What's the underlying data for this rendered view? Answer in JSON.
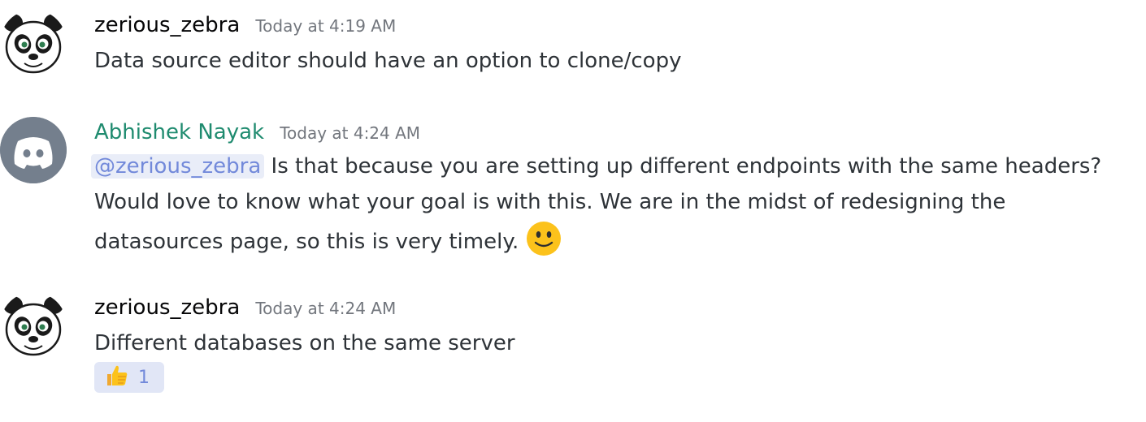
{
  "messages": [
    {
      "author": "zerious_zebra",
      "timestamp": "Today at 4:19 AM",
      "avatar_icon": "panda-icon",
      "text": "Data source editor should have an option to clone/copy"
    },
    {
      "author": "Abhishek Nayak",
      "author_color": "#1f8b6f",
      "timestamp": "Today at 4:24 AM",
      "avatar_icon": "discord-logo-icon",
      "avatar_bg": "#747f8d",
      "mention": "@zerious_zebra",
      "line1": " Is that because you are setting up different endpoints with the same headers?",
      "line2": "Would love to know what your goal is with this. We are in the midst of redesigning the",
      "line3": "datasources page, so this is very timely.",
      "emoji": "slightly-smiling-face-icon"
    },
    {
      "author": "zerious_zebra",
      "timestamp": "Today at 4:24 AM",
      "avatar_icon": "panda-icon",
      "text": "Different databases on the same server",
      "reaction": {
        "emoji": "thumbs-up-icon",
        "count": "1"
      }
    }
  ],
  "colors": {
    "mention_bg": "#e9edf8",
    "mention_fg": "#7289da",
    "timestamp": "#72767d",
    "reaction_bg": "#e1e6f6"
  }
}
